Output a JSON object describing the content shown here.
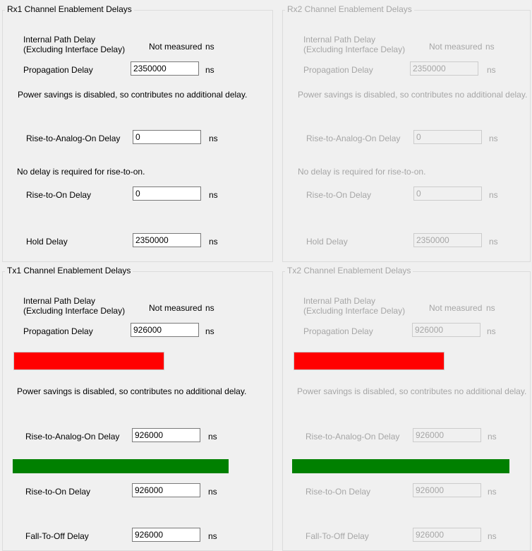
{
  "rx1": {
    "title": "Rx1 Channel Enablement Delays",
    "internal_label_1": "Internal Path Delay",
    "internal_label_2": "(Excluding Interface Delay)",
    "internal_value": "Not measured",
    "propagation_label": "Propagation Delay",
    "propagation_value": "2350000",
    "power_note": "Power savings is disabled, so contributes no additional delay.",
    "rise_analog_label": "Rise-to-Analog-On Delay",
    "rise_analog_value": "0",
    "rise_on_note": "No delay is required for rise-to-on.",
    "rise_on_label": "Rise-to-On Delay",
    "rise_on_value": "0",
    "hold_label": "Hold Delay",
    "hold_value": "2350000",
    "unit": "ns"
  },
  "rx2": {
    "title": "Rx2 Channel Enablement Delays",
    "internal_label_1": "Internal Path Delay",
    "internal_label_2": "(Excluding Interface Delay)",
    "internal_value": "Not measured",
    "propagation_label": "Propagation Delay",
    "propagation_value": "2350000",
    "power_note": "Power savings is disabled, so contributes no additional delay.",
    "rise_analog_label": "Rise-to-Analog-On Delay",
    "rise_analog_value": "0",
    "rise_on_note": "No delay is required for rise-to-on.",
    "rise_on_label": "Rise-to-On Delay",
    "rise_on_value": "0",
    "hold_label": "Hold Delay",
    "hold_value": "2350000",
    "unit": "ns"
  },
  "tx1": {
    "title": "Tx1 Channel Enablement Delays",
    "internal_label_1": "Internal Path Delay",
    "internal_label_2": "(Excluding Interface Delay)",
    "internal_value": "Not measured",
    "propagation_label": "Propagation Delay",
    "propagation_value": "926000",
    "power_note": "Power savings is disabled, so contributes no additional delay.",
    "rise_analog_label": "Rise-to-Analog-On Delay",
    "rise_analog_value": "926000",
    "rise_on_label": "Rise-to-On Delay",
    "rise_on_value": "926000",
    "fall_off_label": "Fall-To-Off Delay",
    "fall_off_value": "926000",
    "unit": "ns"
  },
  "tx2": {
    "title": "Tx2 Channel Enablement Delays",
    "internal_label_1": "Internal Path Delay",
    "internal_label_2": "(Excluding Interface Delay)",
    "internal_value": "Not measured",
    "propagation_label": "Propagation Delay",
    "propagation_value": "926000",
    "power_note": "Power savings is disabled, so contributes no additional delay.",
    "rise_analog_label": "Rise-to-Analog-On Delay",
    "rise_analog_value": "926000",
    "rise_on_label": "Rise-to-On Delay",
    "rise_on_value": "926000",
    "fall_off_label": "Fall-To-Off Delay",
    "fall_off_value": "926000",
    "unit": "ns"
  },
  "colors": {
    "status_red": "#ff0000",
    "status_green": "#008000"
  }
}
